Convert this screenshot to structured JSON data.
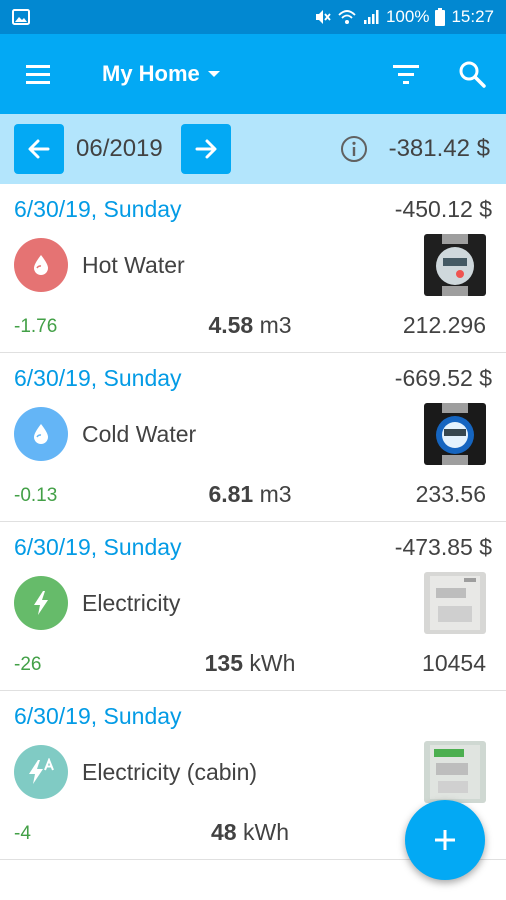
{
  "status_bar": {
    "battery": "100%",
    "time": "15:27"
  },
  "app_bar": {
    "title": "My Home"
  },
  "period": {
    "month": "06/2019",
    "total": "-381.42 $"
  },
  "colors": {
    "primary": "#03a9f4",
    "primary_dark": "#0288d1",
    "period_bar": "#b3e5fc",
    "date_text": "#039be5",
    "delta_text": "#43a047",
    "hot_water": "#e57373",
    "cold_water": "#64b5f6",
    "electricity": "#66bb6a",
    "electricity_cabin": "#80cbc4"
  },
  "entries": [
    {
      "date": "6/30/19, Sunday",
      "cost": "-450.12 $",
      "meter": "Hot Water",
      "icon": "water-drop-icon",
      "delta": "-1.76",
      "usage_value": "4.58",
      "usage_unit": " m3",
      "reading": "212.296"
    },
    {
      "date": "6/30/19, Sunday",
      "cost": "-669.52 $",
      "meter": "Cold Water",
      "icon": "water-drop-icon",
      "delta": "-0.13",
      "usage_value": "6.81",
      "usage_unit": " m3",
      "reading": "233.56"
    },
    {
      "date": "6/30/19, Sunday",
      "cost": "-473.85 $",
      "meter": "Electricity",
      "icon": "lightning-bolt-icon",
      "delta": "-26",
      "usage_value": "135",
      "usage_unit": " kWh",
      "reading": "10454"
    },
    {
      "date": "6/30/19, Sunday",
      "cost": "",
      "meter": "Electricity (cabin)",
      "icon": "lightning-bolt-a-icon",
      "delta": "-4",
      "usage_value": "48",
      "usage_unit": " kWh",
      "reading": ""
    }
  ]
}
